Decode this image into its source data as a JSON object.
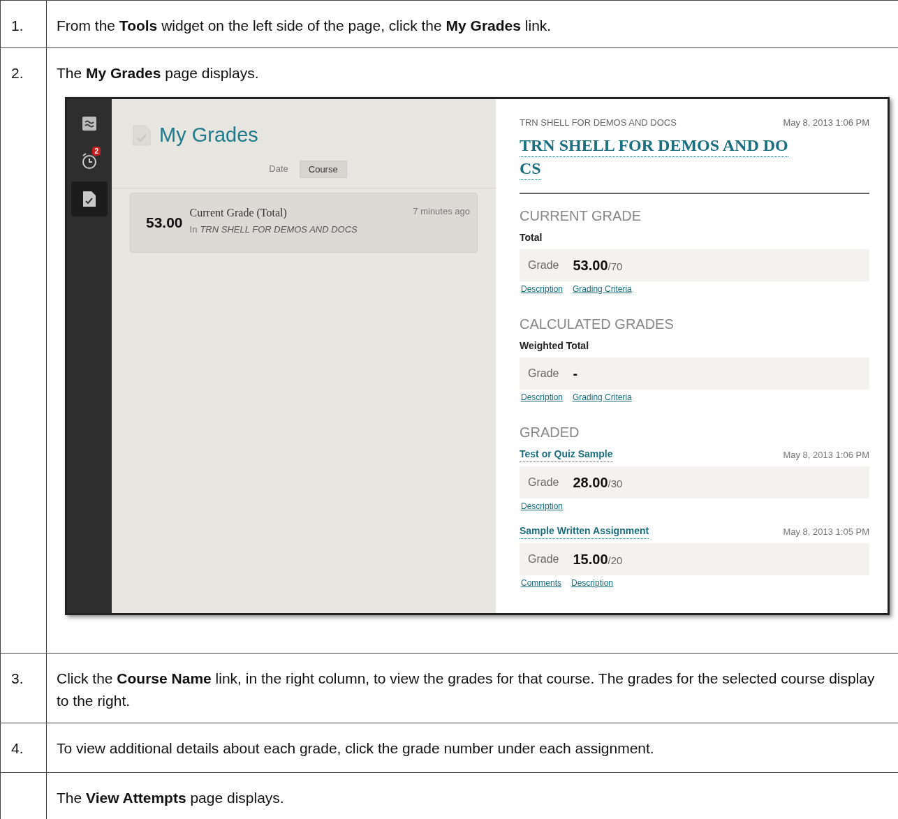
{
  "steps": [
    {
      "number": "1.",
      "text": "From the **Tools** widget on the left side of the page, click the **My Grades** link."
    },
    {
      "number": "2.",
      "text": "The **My Grades** page displays.",
      "screenshot": true
    },
    {
      "number": "3.",
      "text": "Click the **Course Name** link, in the right column, to view the grades for that course. The grades for the selected course display to the right."
    },
    {
      "number": "4.",
      "text": "To view additional details about each grade, click the grade number under each assignment."
    },
    {
      "text": "The **View Attempts** page displays."
    }
  ],
  "app": {
    "sidebar": [
      {
        "kind": "stream",
        "selected": false
      },
      {
        "kind": "alarm",
        "selected": false,
        "badge": "2"
      },
      {
        "kind": "grades",
        "selected": true
      }
    ],
    "title": "My Grades",
    "sort_tabs": [
      {
        "label": "Date",
        "selected": false
      },
      {
        "label": "Course",
        "selected": true
      }
    ],
    "grade_cards": [
      {
        "grade": "53.00",
        "title": "Current Grade (Total)",
        "prefix": "In",
        "course": "TRN SHELL FOR DEMOS AND DOCS",
        "time": "7 minutes ago"
      }
    ],
    "detail": {
      "course_label": "TRN SHELL FOR DEMOS AND DOCS",
      "date": "May 8, 2013 1:06 PM",
      "course_title": "TRN SHELL FOR DEMOS AND DO\nCS",
      "sections": [
        {
          "heading": "CURRENT GRADE",
          "items": [
            {
              "kind": "plain",
              "name": "Total",
              "grade_label": "Grade",
              "grade": "53.00",
              "out_of": "/70",
              "links": [
                "Description",
                "Grading Criteria"
              ]
            }
          ]
        },
        {
          "heading": "CALCULATED GRADES",
          "items": [
            {
              "kind": "plain",
              "name": "Weighted Total",
              "grade_label": "Grade",
              "grade": "-",
              "links": [
                "Description",
                "Grading Criteria"
              ]
            }
          ]
        },
        {
          "heading": "GRADED",
          "items": [
            {
              "kind": "link",
              "name": "Test or Quiz Sample",
              "date": "May 8, 2013 1:06 PM",
              "grade_label": "Grade",
              "grade": "28.00",
              "out_of": "/30",
              "links": [
                "Description"
              ]
            },
            {
              "kind": "link",
              "name": "Sample Written Assignment",
              "date": "May 8, 2013 1:05 PM",
              "grade_label": "Grade",
              "grade": "15.00",
              "out_of": "/20",
              "links": [
                "Comments",
                "Description"
              ]
            }
          ]
        }
      ]
    }
  }
}
